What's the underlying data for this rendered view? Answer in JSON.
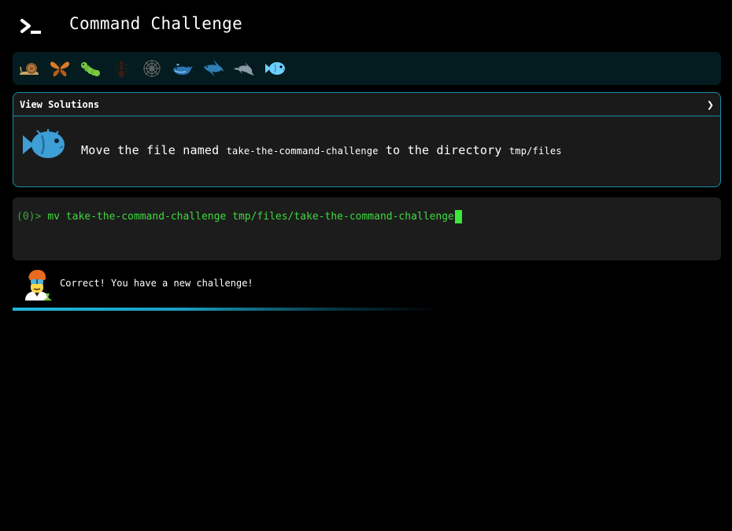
{
  "header": {
    "title": "Command Challenge",
    "logo_icon": "terminal-icon"
  },
  "levels": [
    {
      "icon": "snail-icon",
      "label": "snail",
      "color": "#8a5a2b"
    },
    {
      "icon": "butterfly-icon",
      "label": "butterfly",
      "color": "#d9792a"
    },
    {
      "icon": "caterpillar-icon",
      "label": "caterpillar",
      "color": "#7ac943"
    },
    {
      "icon": "ant-icon",
      "label": "ant",
      "color": "#3a1c10"
    },
    {
      "icon": "spiderweb-icon",
      "label": "spider web",
      "color": "#6a6a6a"
    },
    {
      "icon": "whale-icon",
      "label": "whale",
      "color": "#2b78b8"
    },
    {
      "icon": "shark-icon",
      "label": "shark",
      "color": "#2f7fb5"
    },
    {
      "icon": "dolphin-icon",
      "label": "dolphin",
      "color": "#8a9aa6"
    },
    {
      "icon": "fish-icon",
      "label": "blowfish",
      "color": "#6fd0ff",
      "active": true
    }
  ],
  "challenge": {
    "header_label": "View Solutions",
    "chevron": "❯",
    "icon": "fish-icon",
    "task_prefix": "Move the file named",
    "file_name": "take-the-command-challenge",
    "task_middle": "to the directory",
    "directory": "tmp/files"
  },
  "terminal": {
    "prompt": "(0)>",
    "command": "mv take-the-command-challenge tmp/files/take-the-command-challenge"
  },
  "feedback": {
    "avatar_icon": "scientist-avatar-icon",
    "message": "Correct! You have a new challenge!"
  },
  "colors": {
    "accent": "#1ec8f0",
    "border": "#1a8cab",
    "terminal_green": "#3ed93e",
    "level_bar_bg": "#041c20"
  }
}
